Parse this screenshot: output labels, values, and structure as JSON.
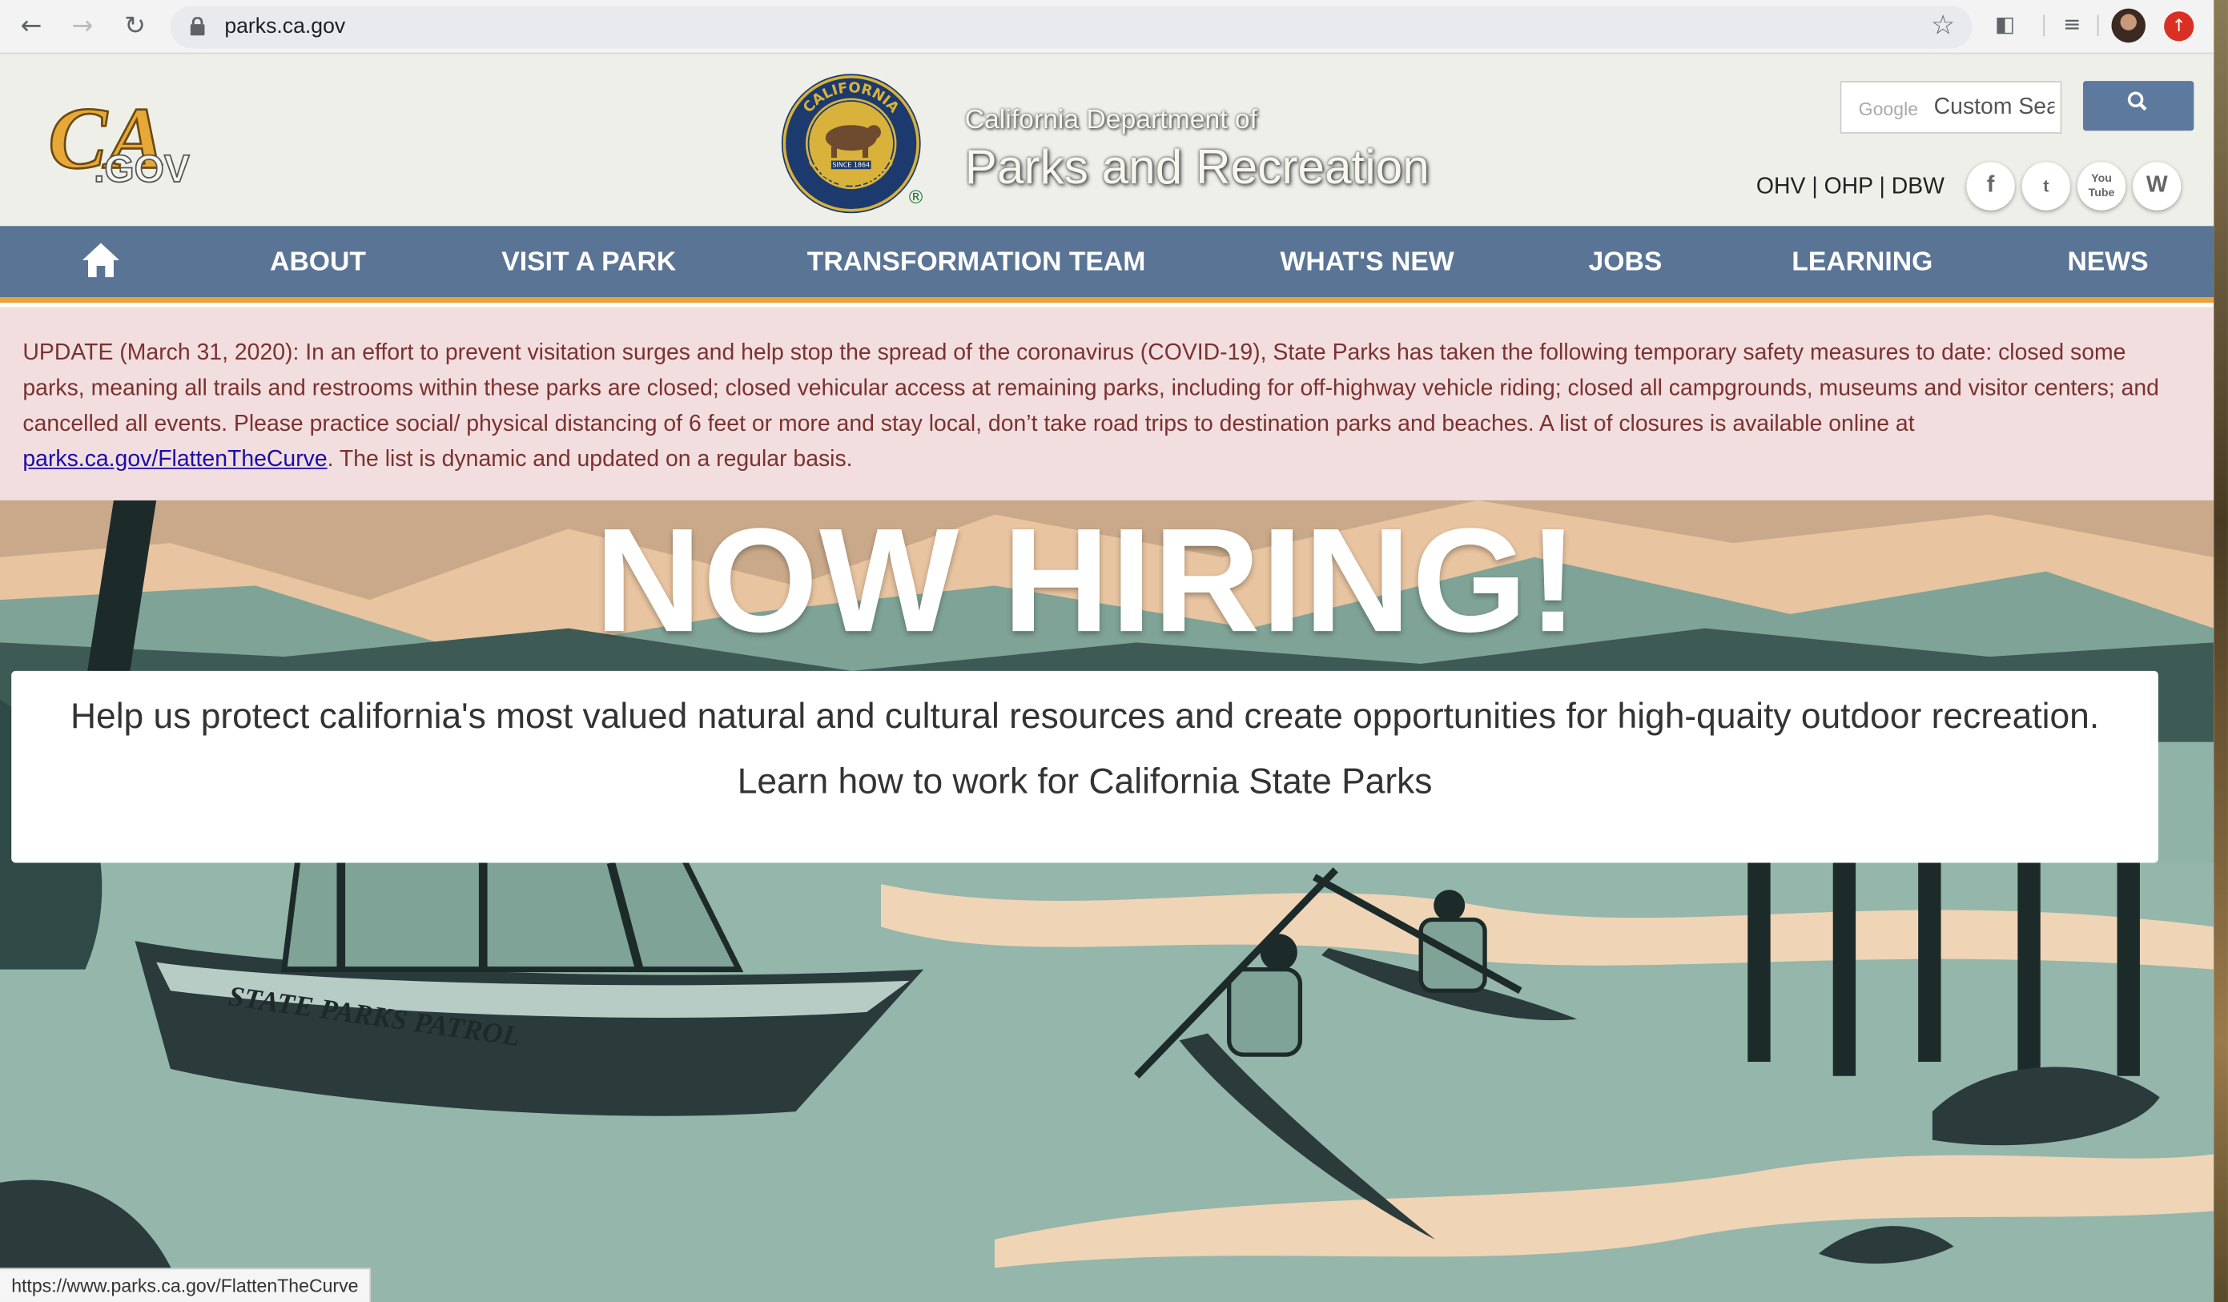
{
  "browser": {
    "url": "parks.ca.gov",
    "status_url": "https://www.parks.ca.gov/FlattenTheCurve"
  },
  "header": {
    "logo_text": "CA.GOV",
    "dept_line": "California Department of",
    "title": "Parks and Recreation",
    "search_brand": "Google",
    "search_placeholder": "Custom Search",
    "top_links": "OHV | OHP | DBW",
    "social": [
      "f",
      "t",
      "You Tube",
      "W"
    ]
  },
  "nav": {
    "items": [
      "ABOUT",
      "VISIT A PARK",
      "TRANSFORMATION TEAM",
      "WHAT'S NEW",
      "JOBS",
      "LEARNING",
      "NEWS"
    ]
  },
  "alert": {
    "text": "UPDATE (March 31, 2020): In an effort to prevent visitation surges and help stop the spread of the coronavirus (COVID-19), State Parks has taken the following temporary safety measures to date: closed some parks, meaning all trails and restrooms within these parks are closed; closed vehicular access at remaining parks, including for off-highway vehicle riding; closed all campgrounds, museums and visitor centers; and cancelled all events. Please practice social/ physical distancing of 6 feet or more and stay local, don’t take road trips to destination parks and beaches. A list of closures is available online at ",
    "link_text": "parks.ca.gov/FlattenTheCurve",
    "tail": ". The list is dynamic and updated on a regular basis."
  },
  "hero": {
    "headline": "NOW HIRING!",
    "line1": "Help us protect california's most valued natural and cultural resources and create opportunities for high-quaity outdoor recreation.",
    "line2": "Learn how to work for California State Parks",
    "boat_text": "STATE PARKS PATROL"
  },
  "colors": {
    "nav_bg": "#5a7496",
    "nav_border": "#e8a33d",
    "alert_bg": "#f2dede",
    "alert_text": "#7b3131"
  }
}
